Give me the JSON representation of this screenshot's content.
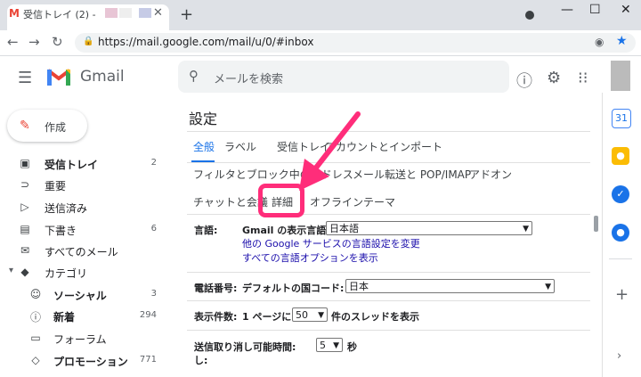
{
  "browser": {
    "tab_favicon": "M",
    "tab_title": "受信トレイ (2) -",
    "tab_close": "✕",
    "new_tab": "+",
    "url": "https://mail.google.com/mail/u/0/#inbox"
  },
  "gmail": {
    "logo_text": "Gmail",
    "search_placeholder": "メールを検索",
    "compose_label": "作成"
  },
  "sidebar": {
    "items": [
      {
        "icon": "inbox-icon",
        "glyph": "▣",
        "label": "受信トレイ",
        "count": "2",
        "bold": true
      },
      {
        "icon": "important-icon",
        "glyph": "⊃",
        "label": "重要",
        "count": ""
      },
      {
        "icon": "send-icon",
        "glyph": "▷",
        "label": "送信済み",
        "count": ""
      },
      {
        "icon": "draft-icon",
        "glyph": "▤",
        "label": "下書き",
        "count": "6"
      },
      {
        "icon": "all-mail-icon",
        "glyph": "✉",
        "label": "すべてのメール",
        "count": ""
      },
      {
        "icon": "label-icon",
        "glyph": "◆",
        "label": "カテゴリ",
        "count": ""
      },
      {
        "icon": "social-icon",
        "glyph": "☺",
        "label": "ソーシャル",
        "count": "3",
        "bold": true
      },
      {
        "icon": "info-icon",
        "glyph": "ⓘ",
        "label": "新着",
        "count": "294",
        "bold": true
      },
      {
        "icon": "forum-icon",
        "glyph": "▭",
        "label": "フォーラム",
        "count": ""
      },
      {
        "icon": "promotion-icon",
        "glyph": "◇",
        "label": "プロモーション",
        "count": "771",
        "bold": true
      }
    ]
  },
  "settings": {
    "title": "設定",
    "tabs_row1": [
      "全般",
      "ラベル",
      "受信トレイ",
      "アカウントとインポート"
    ],
    "tabs_row2": [
      "フィルタとブロック中のアドレス",
      "メール転送と POP/IMAP",
      "アドオン"
    ],
    "tabs_row3": [
      "チャットと会議",
      "詳細",
      "オフライン",
      "テーマ"
    ],
    "language_label": "言語:",
    "display_language_label": "Gmail の表示言語:",
    "display_language_value": "日本語",
    "link_other": "他の Google サービスの言語設定を変更",
    "link_all": "すべての言語オプションを表示",
    "phone_label": "電話番号:",
    "default_country_label": "デフォルトの国コード:",
    "default_country_value": "日本",
    "page_size_label": "表示件数:",
    "page_size_prefix": "1 ページに",
    "page_size_value": "50",
    "page_size_suffix": "件のスレッドを表示",
    "undo_label": "送信取り消し可能時間:",
    "undo_label_2": "し:",
    "undo_value": "5",
    "undo_suffix": "秒"
  },
  "colors": {
    "highlight": "#ff2d7a",
    "active_tab": "#1a73e8"
  }
}
